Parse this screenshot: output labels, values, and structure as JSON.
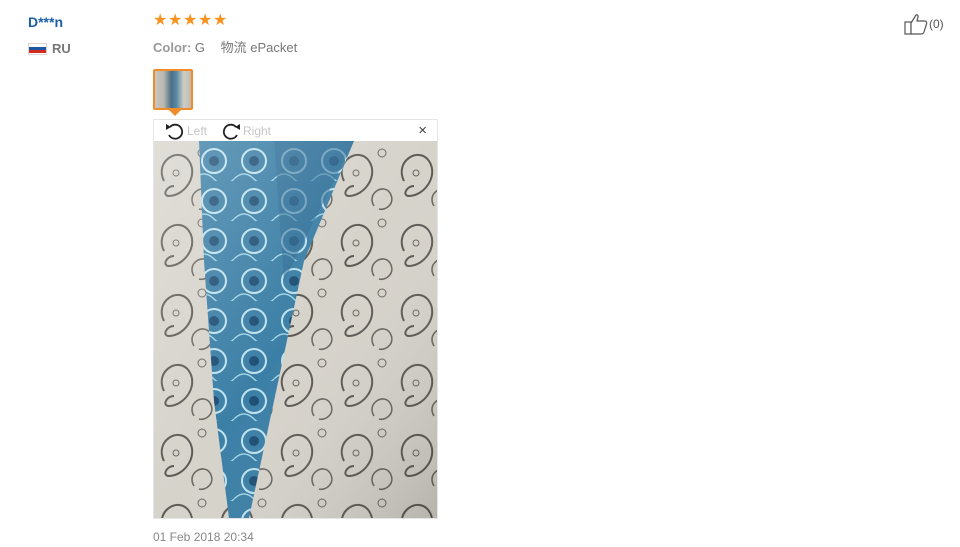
{
  "review": {
    "user_name": "D***n",
    "country_code": "RU",
    "stars": 5,
    "attributes": {
      "color_label": "Color:",
      "color_value": "G",
      "shipping_value": "物流 ePacket"
    },
    "viewer": {
      "rotate_left_label": "Left",
      "rotate_right_label": "Right",
      "close_label": "×"
    },
    "date": "01 Feb 2018 20:34",
    "helpful_count": "(0)"
  },
  "colors": {
    "username": "#1a5fa8",
    "star": "#f7931e",
    "thumb_border": "#f08c2a"
  },
  "icons": {
    "rotate_left": "rotate-left-icon",
    "rotate_right": "rotate-right-icon",
    "close": "close-icon",
    "thumbs_up": "thumbs-up-icon",
    "flag": "russia-flag-icon"
  }
}
